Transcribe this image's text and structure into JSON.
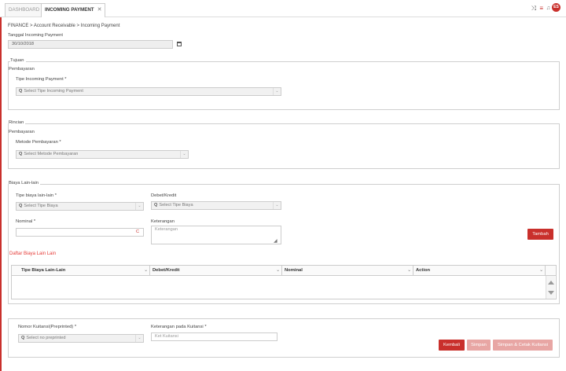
{
  "tabs": [
    {
      "label": "DASHBOARD"
    },
    {
      "label": "INCOMING PAYMENT",
      "close": "✕"
    }
  ],
  "header": {
    "icons": [
      "shuffle-icon",
      "list-icon",
      "bell-icon"
    ],
    "avatar_initials": "ES"
  },
  "breadcrumb": "FINANCE > Account Receivable > Incoming Payment",
  "tanggal": {
    "label": "Tanggal Incoming Payment",
    "value": "30/10/2018"
  },
  "tujuan": {
    "legend_line1": "Tujuan",
    "legend_line2": "Pembayaran",
    "tipe_label": "Tipe Incoming Payment *",
    "tipe_placeholder": "Select Tipe Incoming Payment"
  },
  "rincian": {
    "legend_line1": "Rincian",
    "legend_line2": "Pembayaran",
    "metode_label": "Metode Pembayaran *",
    "metode_placeholder": "Select Metode Pembayaran"
  },
  "biaya": {
    "legend": "Biaya Lain-lain",
    "tipe_label": "Tipe biaya lain-lain *",
    "tipe_placeholder": "Select Tipe Biaya",
    "debet_label": "Debet/Kredit",
    "debet_placeholder": "Select Tipe Biaya",
    "nominal_label": "Nominal *",
    "nominal_suffix": "C",
    "keterangan_label": "Keterangan",
    "keterangan_placeholder": "Keterangan",
    "tambah": "Tambah",
    "daftar_title": "Daftar Biaya Lain Lain",
    "columns": [
      "Tipe Biaya Lain-Lain",
      "Debet/Kredit",
      "Nominal",
      "Action"
    ]
  },
  "kuitansi": {
    "nomor_label": "Nomor Kuitansi(Preprinted) *",
    "nomor_placeholder": "Select no preprinted",
    "ket_label": "Keterangan pada Kuitansi *",
    "ket_placeholder": "Ket Kuitansi"
  },
  "actions": {
    "kembali": "Kembali",
    "simpan": "Simpan",
    "simpan_cetak": "Simpan & Cetak Kuitansi"
  },
  "colors": {
    "accent": "#c9302c",
    "accent_light": "#e8a6a4",
    "daftar": "#e53935"
  }
}
